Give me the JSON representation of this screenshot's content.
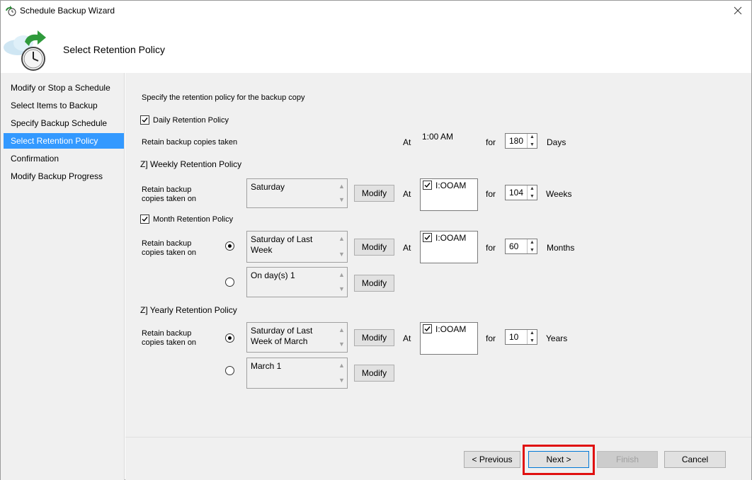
{
  "window": {
    "title": "Schedule Backup Wizard",
    "close_glyph": "✕"
  },
  "header": {
    "title": "Select Retention Policy"
  },
  "sidebar": {
    "items": [
      {
        "label": "Modify or Stop a Schedule",
        "active": false
      },
      {
        "label": "Select Items to Backup",
        "active": false
      },
      {
        "label": "Specify Backup Schedule",
        "active": false
      },
      {
        "label": "Select Retention Policy",
        "active": true
      },
      {
        "label": "Confirmation",
        "active": false
      },
      {
        "label": "Modify Backup Progress",
        "active": false
      }
    ]
  },
  "main": {
    "intro": "Specify the retention policy for the backup copy",
    "daily": {
      "checkbox_label": "Daily Retention Policy",
      "checked": true,
      "retain_label": "Retain backup copies taken",
      "at_label": "At",
      "time": "1:00 AM",
      "for_label": "for",
      "value": "180",
      "unit": "Days"
    },
    "weekly": {
      "heading": "Z] Weekly Retention Policy",
      "retain_label_1": "Retain backup",
      "retain_label_2": "copies taken on",
      "schedule": "Saturday",
      "modify_label": "Modify",
      "at_label": "At",
      "time": "I:OOAM",
      "for_label": "for",
      "value": "104",
      "unit": "Weeks"
    },
    "monthly": {
      "checkbox_label": "Month Retention Policy",
      "checked": true,
      "retain_label_1": "Retain backup",
      "retain_label_2": "copies taken on",
      "option1_line1": "Saturday of Last",
      "option1_line2": "Week",
      "option1_selected": true,
      "option2": "On day(s) 1",
      "modify_label": "Modify",
      "at_label": "At",
      "time": "I:OOAM",
      "for_label": "for",
      "value": "60",
      "unit": "Months"
    },
    "yearly": {
      "heading": "Z] Yearly Retention Policy",
      "retain_label_1": "Retain backup",
      "retain_label_2": "copies taken on",
      "option1_line1": "Saturday of Last",
      "option1_line2": "Week of March",
      "option1_selected": true,
      "option2": "March 1",
      "modify_label": "Modify",
      "at_label": "At",
      "time": "I:OOAM",
      "for_label": "for",
      "value": "10",
      "unit": "Years"
    }
  },
  "footer": {
    "previous_label": "< Previous",
    "next_label": "Next >",
    "finish_label": "Finish",
    "cancel_label": "Cancel"
  },
  "colors": {
    "accent": "#3399ff",
    "highlight": "#e01010"
  }
}
